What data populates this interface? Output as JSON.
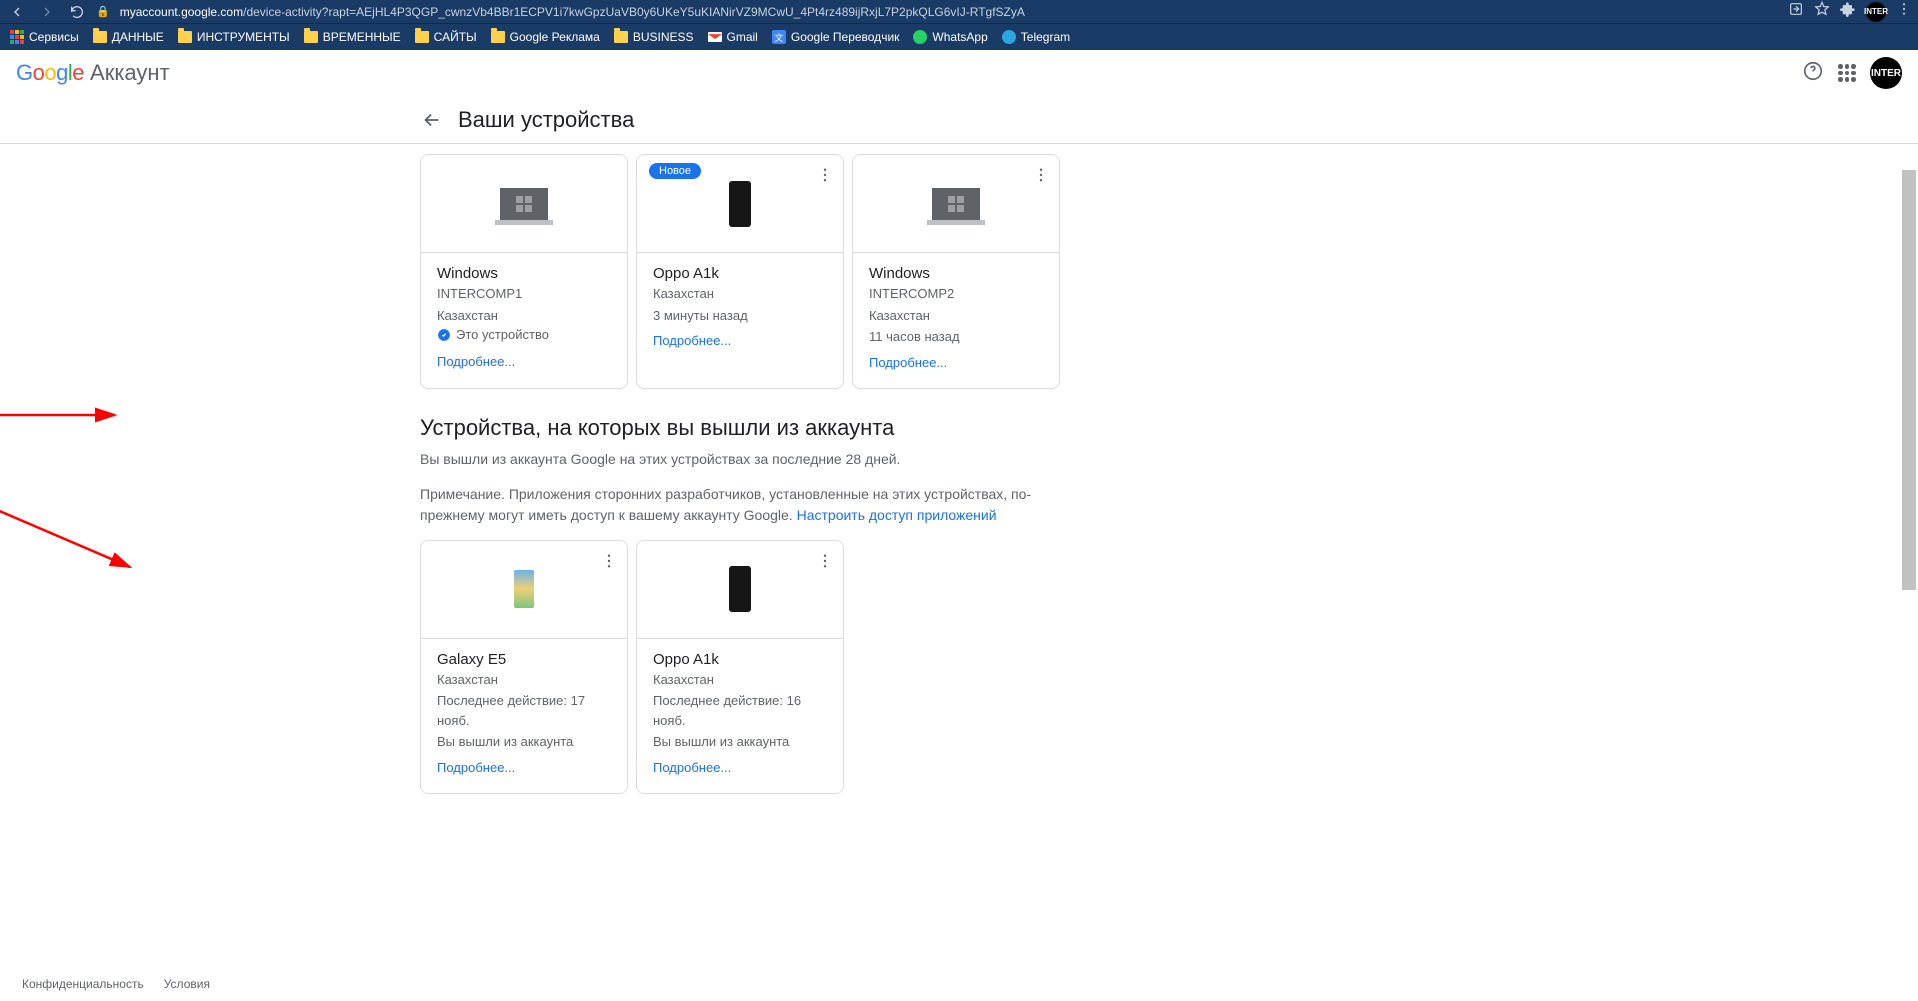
{
  "browser": {
    "url_host": "myaccount.google.com",
    "url_path": "/device-activity?rapt=AEjHL4P3QGP_cwnzVb4BBr1ECPV1i7kwGpzUaVB0y6UKeY5uKIANirVZ9MCwU_4Pt4rz489ijRxjL7P2pkQLG6vIJ-RTgfSZyA"
  },
  "bookmarks": {
    "services": "Сервисы",
    "data": "ДАННЫЕ",
    "tools": "ИНСТРУМЕНТЫ",
    "temp": "ВРЕМЕННЫЕ",
    "sites": "САЙТЫ",
    "ads": "Google Реклама",
    "biz": "BUSINESS",
    "gmail": "Gmail",
    "translate": "Google Переводчик",
    "whatsapp": "WhatsApp",
    "telegram": "Telegram"
  },
  "header": {
    "account_text": "Аккаунт"
  },
  "subheader": {
    "title": "Ваши устройства"
  },
  "active_devices": [
    {
      "name": "Windows",
      "sub1": "INTERCOMP1",
      "sub2": "Казахстан",
      "this_device": "Это устройство",
      "link": "Подробнее..."
    },
    {
      "badge": "Новое",
      "name": "Oppo A1k",
      "sub1": "Казахстан",
      "sub2": "3 минуты назад",
      "link": "Подробнее..."
    },
    {
      "name": "Windows",
      "sub1": "INTERCOMP2",
      "sub2": "Казахстан",
      "sub3": "11 часов назад",
      "link": "Подробнее..."
    }
  ],
  "signed_out_section": {
    "title": "Устройства, на которых вы вышли из аккаунта",
    "desc1": "Вы вышли из аккаунта Google на этих устройствах за последние 28 дней.",
    "desc2_a": "Примечание. Приложения сторонних разработчиков, установленные на этих устройствах, по-прежнему могут иметь доступ к вашему аккаунту Google. ",
    "desc2_link": "Настроить доступ приложений"
  },
  "signed_out_devices": [
    {
      "name": "Galaxy E5",
      "sub1": "Казахстан",
      "sub2": "Последнее действие: 17 нояб.",
      "sub3": "Вы вышли из аккаунта",
      "link": "Подробнее..."
    },
    {
      "name": "Oppo A1k",
      "sub1": "Казахстан",
      "sub2": "Последнее действие: 16 нояб.",
      "sub3": "Вы вышли из аккаунта",
      "link": "Подробнее..."
    }
  ],
  "footer": {
    "privacy": "Конфиденциальность",
    "terms": "Условия"
  }
}
